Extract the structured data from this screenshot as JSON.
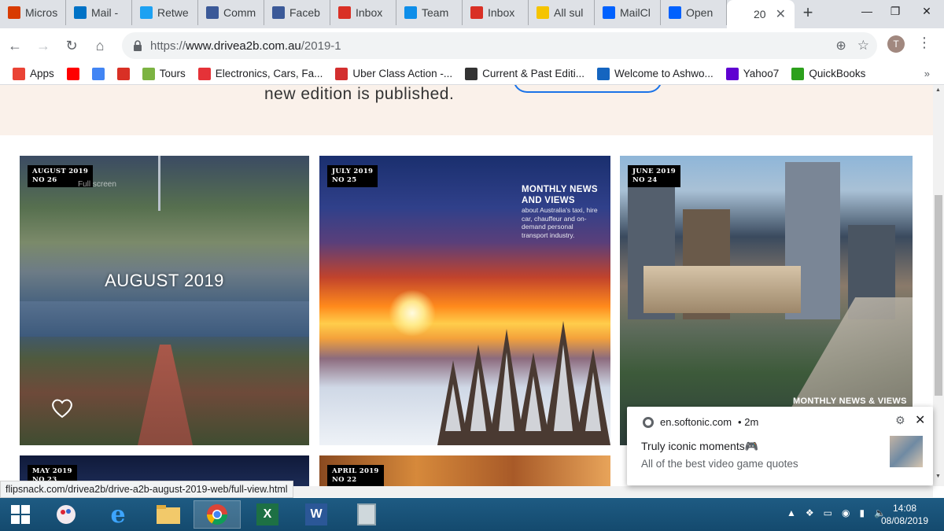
{
  "tabs": [
    {
      "label": "Micros",
      "icon": "office-icon",
      "color": "#d83b01"
    },
    {
      "label": "Mail -",
      "icon": "outlook-icon",
      "color": "#0072c6"
    },
    {
      "label": "Retwe",
      "icon": "twitter-icon",
      "color": "#1da1f2"
    },
    {
      "label": "Comm",
      "icon": "facebook-icon",
      "color": "#3b5998"
    },
    {
      "label": "Faceb",
      "icon": "facebook-icon",
      "color": "#3b5998"
    },
    {
      "label": "Inbox",
      "icon": "gmail-icon",
      "color": "#d93025"
    },
    {
      "label": "Team",
      "icon": "teamviewer-icon",
      "color": "#0e8ee9"
    },
    {
      "label": "Inbox",
      "icon": "gmail-icon",
      "color": "#d93025"
    },
    {
      "label": "All sul",
      "icon": "nc-icon",
      "color": "#f5c400"
    },
    {
      "label": "MailCl",
      "icon": "dropbox-icon",
      "color": "#0061fe"
    },
    {
      "label": "Open",
      "icon": "dropbox-icon",
      "color": "#0061fe"
    }
  ],
  "active_tab": {
    "label": "20"
  },
  "address": {
    "scheme": "https://",
    "host": "www.drivea2b.com.au",
    "path": "/2019-1"
  },
  "profile_initial": "T",
  "bookmarks": [
    {
      "label": "Apps",
      "icon": "apps-grid-icon",
      "color": "#ea4335"
    },
    {
      "label": "",
      "icon": "youtube-icon",
      "color": "#ff0000"
    },
    {
      "label": "",
      "icon": "google-icon",
      "color": "#4285f4"
    },
    {
      "label": "",
      "icon": "gmail-icon",
      "color": "#d93025"
    },
    {
      "label": "Tours",
      "icon": "tours-icon",
      "color": "#7cb342"
    },
    {
      "label": "Electronics, Cars, Fa...",
      "icon": "ebay-icon",
      "color": "#e53238"
    },
    {
      "label": "Uber Class Action -...",
      "icon": "mb-icon",
      "color": "#d32f2f"
    },
    {
      "label": "Current & Past Editi...",
      "icon": "a2b-icon",
      "color": "#333333"
    },
    {
      "label": "Welcome to Ashwo...",
      "icon": "info-icon",
      "color": "#1565c0"
    },
    {
      "label": "Yahoo7",
      "icon": "yahoo-icon",
      "color": "#5f01d1"
    },
    {
      "label": "QuickBooks",
      "icon": "quickbooks-icon",
      "color": "#2ca01c"
    }
  ],
  "page": {
    "hero_text": "new edition is published.",
    "cards": [
      {
        "month": "AUGUST 2019",
        "no": "NO 26",
        "title": "AUGUST 2019",
        "ghost": "Full screen"
      },
      {
        "month": "JULY 2019",
        "no": "NO 25",
        "headline_1": "MONTHLY NEWS",
        "headline_2": "AND VIEWS",
        "sub": "about Australia's taxi, hire car, chauffeur and on-demand personal transport industry."
      },
      {
        "month": "JUNE 2019",
        "no": "NO 24",
        "footer": "MONTHLY NEWS & VIEWS"
      },
      {
        "month": "MAY 2019",
        "no": "NO 23"
      },
      {
        "month": "APRIL 2019",
        "no": "NO 22"
      }
    ]
  },
  "notification": {
    "source": "en.softonic.com",
    "time": "• 2m",
    "title": "Truly iconic moments🎮",
    "body": "All of the best video game quotes"
  },
  "status_link": "flipsnack.com/drivea2b/drive-a2b-august-2019-web/full-view.html",
  "taskbar": {
    "time": "14:08",
    "date": "08/08/2019"
  }
}
